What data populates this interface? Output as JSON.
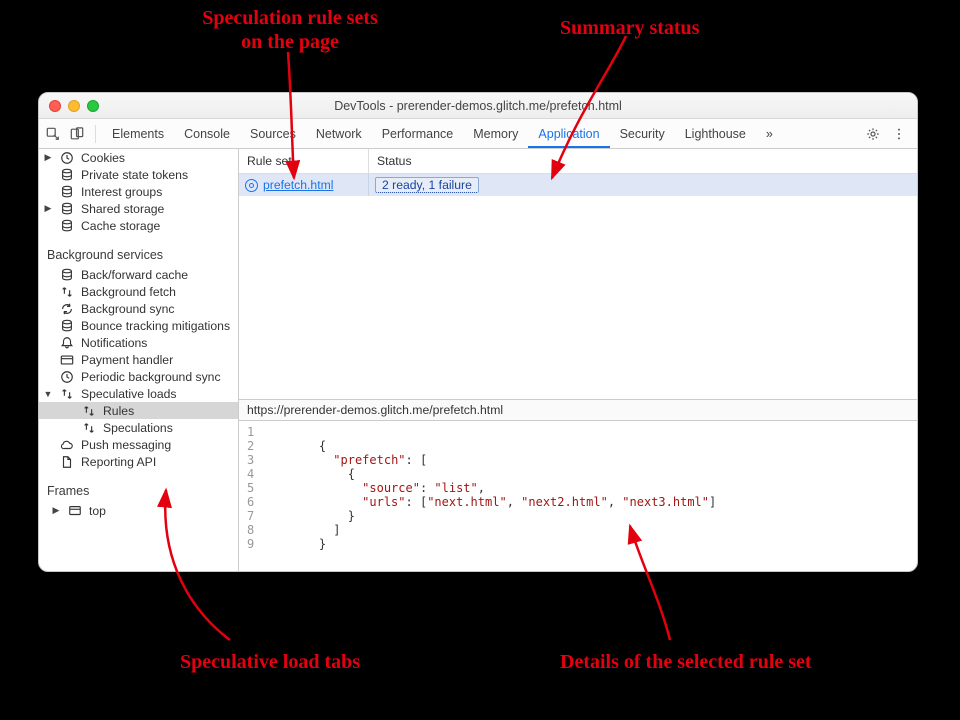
{
  "annotations": {
    "top_left": "Speculation rule sets\non the page",
    "top_right": "Summary status",
    "bottom_left": "Speculative load tabs",
    "bottom_right": "Details of the selected rule set"
  },
  "window": {
    "title": "DevTools - prerender-demos.glitch.me/prefetch.html"
  },
  "tabs": {
    "items": [
      "Elements",
      "Console",
      "Sources",
      "Network",
      "Performance",
      "Memory",
      "Application",
      "Security",
      "Lighthouse"
    ],
    "more_glyph": "»",
    "active_index": 6
  },
  "sidebar": {
    "app_items": [
      {
        "label": "Cookies",
        "icon": "clock",
        "expandable": true
      },
      {
        "label": "Private state tokens",
        "icon": "db"
      },
      {
        "label": "Interest groups",
        "icon": "db"
      },
      {
        "label": "Shared storage",
        "icon": "db",
        "expandable": true
      },
      {
        "label": "Cache storage",
        "icon": "db"
      }
    ],
    "bg_label": "Background services",
    "bg_items": [
      {
        "label": "Back/forward cache",
        "icon": "db"
      },
      {
        "label": "Background fetch",
        "icon": "arrows"
      },
      {
        "label": "Background sync",
        "icon": "sync"
      },
      {
        "label": "Bounce tracking mitigations",
        "icon": "db"
      },
      {
        "label": "Notifications",
        "icon": "bell"
      },
      {
        "label": "Payment handler",
        "icon": "card"
      },
      {
        "label": "Periodic background sync",
        "icon": "clock"
      },
      {
        "label": "Speculative loads",
        "icon": "arrows",
        "expandable": true,
        "open": true,
        "children": [
          {
            "label": "Rules",
            "icon": "arrows",
            "active": true
          },
          {
            "label": "Speculations",
            "icon": "arrows"
          }
        ]
      },
      {
        "label": "Push messaging",
        "icon": "cloud"
      },
      {
        "label": "Reporting API",
        "icon": "file"
      }
    ],
    "frames_label": "Frames",
    "frames_items": [
      {
        "label": "top",
        "icon": "frame",
        "expandable": true
      }
    ]
  },
  "ruletable": {
    "col_ruleset": "Rule set",
    "col_status": "Status",
    "rows": [
      {
        "name": "prefetch.html",
        "status": "2 ready, 1 failure"
      }
    ]
  },
  "urlbar": "https://prerender-demos.glitch.me/prefetch.html",
  "code": {
    "line_count": 9,
    "keys": {
      "prefetch": "\"prefetch\"",
      "source": "\"source\"",
      "urls": "\"urls\"",
      "list": "\"list\"",
      "u1": "\"next.html\"",
      "u2": "\"next2.html\"",
      "u3": "\"next3.html\""
    }
  }
}
